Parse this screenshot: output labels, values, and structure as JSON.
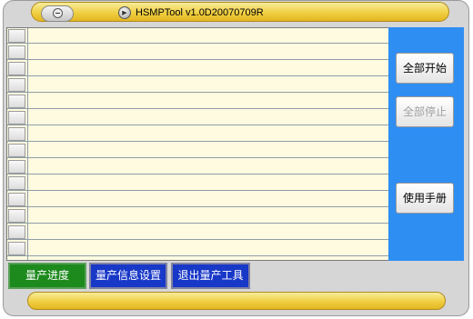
{
  "window": {
    "title": "HSMPTool v1.0D20070709R"
  },
  "grid": {
    "row_count": 14
  },
  "side_buttons": {
    "start_all": "全部开始",
    "stop_all": "全部停止",
    "manual": "使用手册"
  },
  "tabs": [
    {
      "label": "量产进度"
    },
    {
      "label": "量产信息设置"
    },
    {
      "label": "退出量产工具"
    }
  ],
  "colors": {
    "title_bar": "#f0cf42",
    "side_panel": "#2f8ef2",
    "grid_bg": "#fffbe0",
    "tab_active": "#1d8a1d",
    "tab_normal": "#1838c8"
  }
}
